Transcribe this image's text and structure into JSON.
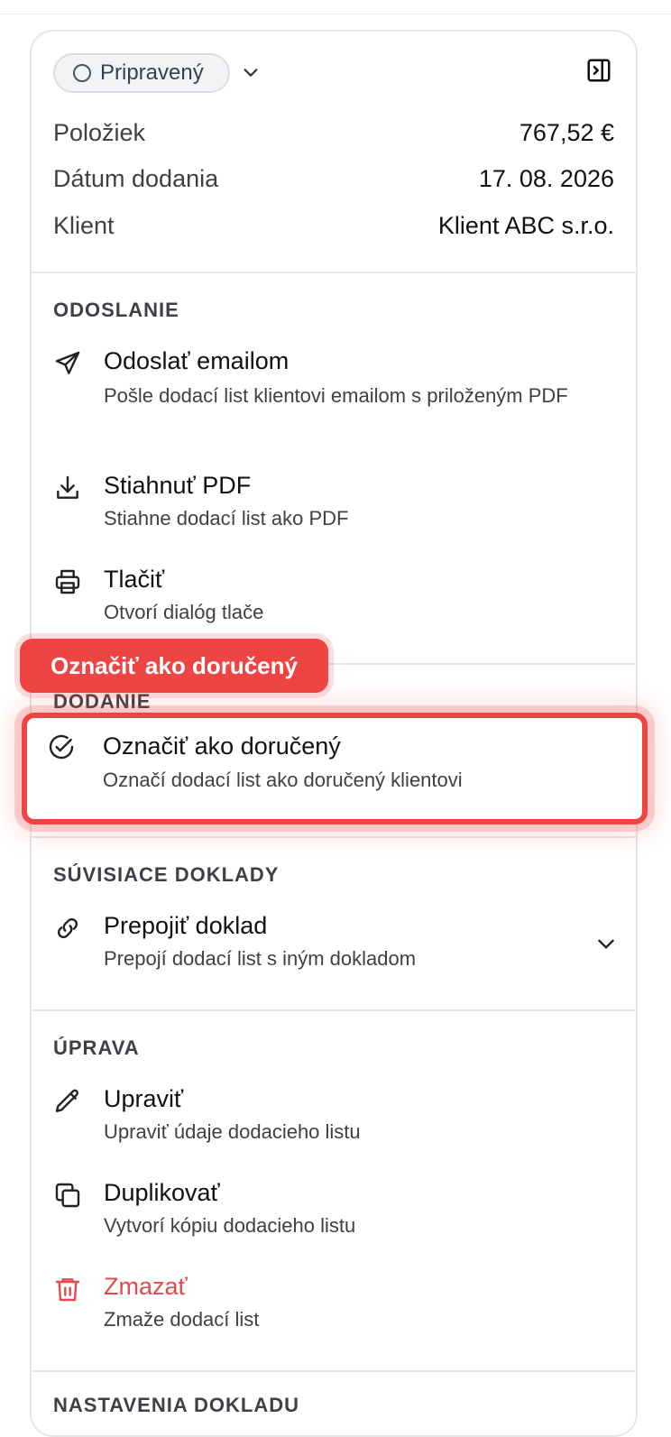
{
  "header": {
    "status_label": "Pripravený",
    "rows": [
      {
        "key": "Položiek",
        "value": "767,52 €"
      },
      {
        "key": "Dátum dodania",
        "value": "17. 08. 2026"
      },
      {
        "key": "Klient",
        "value": "Klient ABC s.r.o."
      }
    ]
  },
  "sections": {
    "odoslanie": {
      "title": "ODOSLANIE",
      "actions": [
        {
          "title": "Odoslať emailom",
          "desc": "Pošle dodací list klientovi emailom s priloženým PDF",
          "icon": "send-icon"
        },
        {
          "title": "Stiahnuť PDF",
          "desc": "Stiahne dodací list ako PDF",
          "icon": "download-icon"
        },
        {
          "title": "Tlačiť",
          "desc": "Otvorí dialóg tlače",
          "icon": "printer-icon"
        }
      ]
    },
    "dodanie": {
      "title": "DODANIE",
      "actions": [
        {
          "title": "Označiť ako doručený",
          "desc": "Označí dodací list ako doručený klientovi",
          "icon": "check-circle-icon"
        }
      ]
    },
    "suvisiace": {
      "title": "SÚVISIACE DOKLADY",
      "actions": [
        {
          "title": "Prepojiť doklad",
          "desc": "Prepojí dodací list s iným dokladom",
          "icon": "link-icon"
        }
      ]
    },
    "uprava": {
      "title": "ÚPRAVA",
      "actions": [
        {
          "title": "Upraviť",
          "desc": "Upraviť údaje dodacieho listu",
          "icon": "pencil-icon"
        },
        {
          "title": "Duplikovať",
          "desc": "Vytvorí kópiu dodacieho listu",
          "icon": "copy-icon"
        },
        {
          "title": "Zmazať",
          "desc": "Zmaže dodací list",
          "icon": "trash-icon"
        }
      ]
    },
    "nastavenia": {
      "title": "NASTAVENIA DOKLADU"
    }
  },
  "tooltip": {
    "label": "Označiť ako doručený"
  },
  "colors": {
    "accent": "#ef4444",
    "danger": "#e5484d",
    "border": "#e6e6e6"
  }
}
